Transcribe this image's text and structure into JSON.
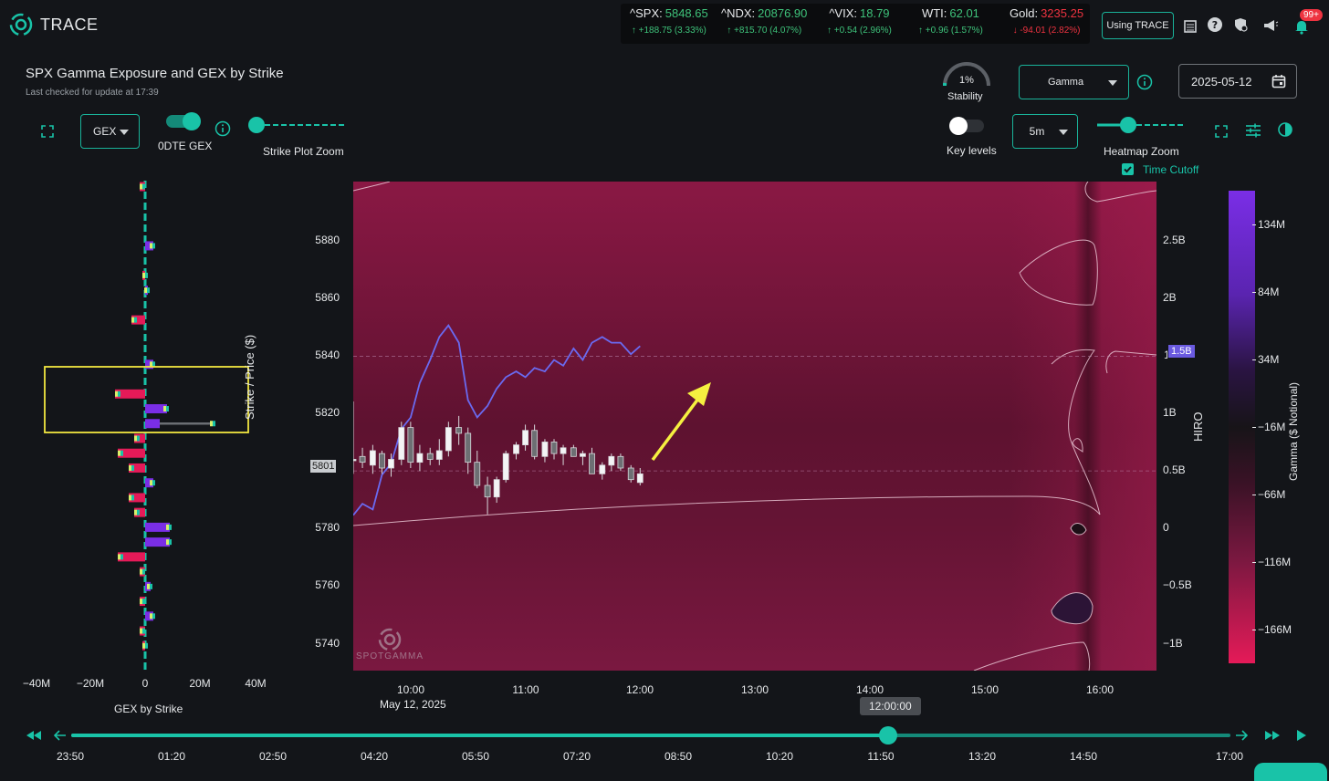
{
  "header": {
    "app_name": "TRACE",
    "using_button": "Using TRACE",
    "notification_count": "99+",
    "tickers": [
      {
        "symbol": "^SPX:",
        "price": "5848.65",
        "change": "↑ +188.75 (3.33%)",
        "direction": "up"
      },
      {
        "symbol": "^NDX:",
        "price": "20876.90",
        "change": "↑ +815.70 (4.07%)",
        "direction": "up"
      },
      {
        "symbol": "^VIX:",
        "price": "18.79",
        "change": "↑ +0.54 (2.96%)",
        "direction": "up"
      },
      {
        "symbol": "WTI:",
        "price": "62.01",
        "change": "↑ +0.96 (1.57%)",
        "direction": "up"
      },
      {
        "symbol": "Gold:",
        "price": "3235.25",
        "change": "↓ -94.01 (2.82%)",
        "direction": "down"
      }
    ]
  },
  "page": {
    "title": "SPX Gamma Exposure and GEX by Strike",
    "subtitle": "Last checked for update at 17:39"
  },
  "controls": {
    "gex_select": "GEX",
    "odte_label": "0DTE GEX",
    "strike_zoom_label": "Strike Plot Zoom",
    "stability_value": "1%",
    "stability_label": "Stability",
    "stability_fraction": 0.01,
    "key_levels_label": "Key levels",
    "gamma_select": "Gamma",
    "interval_select": "5m",
    "heatmap_zoom_label": "Heatmap Zoom",
    "time_cutoff_label": "Time Cutoff",
    "date_value": "2025-05-12"
  },
  "strike_chart": {
    "x_ticks": [
      "−40M",
      "−20M",
      "0",
      "20M",
      "40M"
    ],
    "x_label": "GEX by Strike"
  },
  "heatmap": {
    "y_label": "Strike / Price ($)",
    "y_ticks": [
      "5880",
      "5860",
      "5840",
      "5820",
      "5801",
      "5780",
      "5760",
      "5740"
    ],
    "current_price_label": "5801",
    "x_ticks": [
      "10:00",
      "11:00",
      "12:00",
      "13:00",
      "14:00",
      "15:00",
      "16:00"
    ],
    "date_label": "May 12, 2025",
    "hiro_label": "HIRO",
    "hiro_ticks": [
      "2.5B",
      "2B",
      "1.5B",
      "1B",
      "0.5B",
      "0",
      "−0.5B",
      "−1B"
    ],
    "hiro_current": "1.5B",
    "watermark": "SPOTGAMMA",
    "colorbar_label": "Gamma ($ Notional)",
    "colorbar_ticks": [
      "134M",
      "84M",
      "34M",
      "−16M",
      "−66M",
      "−116M",
      "−166M"
    ]
  },
  "timeline": {
    "current_time": "12:00:00",
    "labels": [
      "23:50",
      "01:20",
      "02:50",
      "04:20",
      "05:50",
      "07:20",
      "08:50",
      "10:20",
      "11:50",
      "13:20",
      "14:50",
      "17:00"
    ],
    "position_fraction": 0.705
  },
  "chart_data": {
    "type": "candlestick",
    "y_range": [
      5732,
      5901
    ],
    "x_range_hours": [
      9.5,
      16.5
    ],
    "candles": [
      {
        "t": 9.5,
        "o": 5805,
        "h": 5825,
        "l": 5800,
        "c": 5805
      },
      {
        "t": 9.58,
        "o": 5806,
        "h": 5809,
        "l": 5802,
        "c": 5804
      },
      {
        "t": 9.67,
        "o": 5803,
        "h": 5810,
        "l": 5800,
        "c": 5808
      },
      {
        "t": 9.75,
        "o": 5807,
        "h": 5808,
        "l": 5800,
        "c": 5802
      },
      {
        "t": 9.83,
        "o": 5802,
        "h": 5807,
        "l": 5799,
        "c": 5805
      },
      {
        "t": 9.92,
        "o": 5805,
        "h": 5818,
        "l": 5803,
        "c": 5816
      },
      {
        "t": 10.0,
        "o": 5816,
        "h": 5818,
        "l": 5802,
        "c": 5804
      },
      {
        "t": 10.08,
        "o": 5804,
        "h": 5810,
        "l": 5801,
        "c": 5807
      },
      {
        "t": 10.17,
        "o": 5807,
        "h": 5809,
        "l": 5803,
        "c": 5805
      },
      {
        "t": 10.25,
        "o": 5805,
        "h": 5812,
        "l": 5803,
        "c": 5808
      },
      {
        "t": 10.33,
        "o": 5808,
        "h": 5818,
        "l": 5806,
        "c": 5816
      },
      {
        "t": 10.42,
        "o": 5816,
        "h": 5820,
        "l": 5810,
        "c": 5814
      },
      {
        "t": 10.5,
        "o": 5814,
        "h": 5816,
        "l": 5800,
        "c": 5804
      },
      {
        "t": 10.58,
        "o": 5804,
        "h": 5808,
        "l": 5795,
        "c": 5796
      },
      {
        "t": 10.67,
        "o": 5796,
        "h": 5799,
        "l": 5786,
        "c": 5792
      },
      {
        "t": 10.75,
        "o": 5792,
        "h": 5799,
        "l": 5790,
        "c": 5798
      },
      {
        "t": 10.83,
        "o": 5798,
        "h": 5808,
        "l": 5797,
        "c": 5807
      },
      {
        "t": 10.92,
        "o": 5807,
        "h": 5811,
        "l": 5805,
        "c": 5810
      },
      {
        "t": 11.0,
        "o": 5810,
        "h": 5817,
        "l": 5808,
        "c": 5815
      },
      {
        "t": 11.08,
        "o": 5815,
        "h": 5817,
        "l": 5805,
        "c": 5806
      },
      {
        "t": 11.17,
        "o": 5806,
        "h": 5812,
        "l": 5804,
        "c": 5811
      },
      {
        "t": 11.25,
        "o": 5811,
        "h": 5812,
        "l": 5805,
        "c": 5807
      },
      {
        "t": 11.33,
        "o": 5807,
        "h": 5810,
        "l": 5803,
        "c": 5809
      },
      {
        "t": 11.42,
        "o": 5809,
        "h": 5810,
        "l": 5806,
        "c": 5806
      },
      {
        "t": 11.5,
        "o": 5806,
        "h": 5808,
        "l": 5803,
        "c": 5807
      },
      {
        "t": 11.58,
        "o": 5807,
        "h": 5809,
        "l": 5800,
        "c": 5800
      },
      {
        "t": 11.67,
        "o": 5800,
        "h": 5804,
        "l": 5798,
        "c": 5803
      },
      {
        "t": 11.75,
        "o": 5803,
        "h": 5807,
        "l": 5801,
        "c": 5806
      },
      {
        "t": 11.83,
        "o": 5806,
        "h": 5807,
        "l": 5801,
        "c": 5802
      },
      {
        "t": 11.92,
        "o": 5802,
        "h": 5803,
        "l": 5797,
        "c": 5798
      },
      {
        "t": 12.0,
        "o": 5797,
        "h": 5802,
        "l": 5796,
        "c": 5800
      }
    ],
    "hiro_line": {
      "series_unit": "B",
      "y_range": [
        -1.25,
        3.0
      ],
      "points": [
        [
          9.5,
          0.1
        ],
        [
          9.58,
          0.2
        ],
        [
          9.67,
          0.15
        ],
        [
          9.75,
          0.45
        ],
        [
          9.83,
          0.55
        ],
        [
          9.92,
          0.85
        ],
        [
          10.0,
          0.95
        ],
        [
          10.08,
          1.25
        ],
        [
          10.17,
          1.45
        ],
        [
          10.25,
          1.65
        ],
        [
          10.33,
          1.75
        ],
        [
          10.42,
          1.6
        ],
        [
          10.5,
          1.1
        ],
        [
          10.58,
          0.95
        ],
        [
          10.67,
          1.05
        ],
        [
          10.75,
          1.2
        ],
        [
          10.83,
          1.3
        ],
        [
          10.92,
          1.35
        ],
        [
          11.0,
          1.3
        ],
        [
          11.08,
          1.38
        ],
        [
          11.17,
          1.35
        ],
        [
          11.25,
          1.45
        ],
        [
          11.33,
          1.4
        ],
        [
          11.42,
          1.55
        ],
        [
          11.5,
          1.45
        ],
        [
          11.58,
          1.6
        ],
        [
          11.67,
          1.65
        ],
        [
          11.75,
          1.6
        ],
        [
          11.83,
          1.6
        ],
        [
          11.92,
          1.5
        ],
        [
          12.0,
          1.57
        ]
      ]
    },
    "strike_bars": {
      "x_range": [
        -40,
        40
      ],
      "strikes": [
        {
          "strike": 5900,
          "gex": -2
        },
        {
          "strike": 5880,
          "gex": 3
        },
        {
          "strike": 5870,
          "gex": -1
        },
        {
          "strike": 5865,
          "gex": 1
        },
        {
          "strike": 5855,
          "gex": -5
        },
        {
          "strike": 5840,
          "gex": 3
        },
        {
          "strike": 5830,
          "gex": -11
        },
        {
          "strike": 5825,
          "gex": 8
        },
        {
          "strike": 5820,
          "gex": 25
        },
        {
          "strike": 5815,
          "gex": -4
        },
        {
          "strike": 5810,
          "gex": -10
        },
        {
          "strike": 5805,
          "gex": -6
        },
        {
          "strike": 5800,
          "gex": 3
        },
        {
          "strike": 5795,
          "gex": -6
        },
        {
          "strike": 5790,
          "gex": -4
        },
        {
          "strike": 5785,
          "gex": 9
        },
        {
          "strike": 5780,
          "gex": 9
        },
        {
          "strike": 5775,
          "gex": -10
        },
        {
          "strike": 5770,
          "gex": -2
        },
        {
          "strike": 5765,
          "gex": 2
        },
        {
          "strike": 5760,
          "gex": -2
        },
        {
          "strike": 5755,
          "gex": 3
        },
        {
          "strike": 5750,
          "gex": -2
        },
        {
          "strike": 5745,
          "gex": -1
        }
      ]
    }
  }
}
